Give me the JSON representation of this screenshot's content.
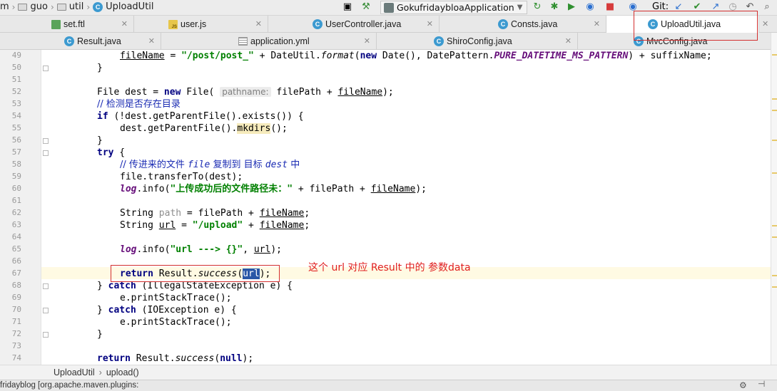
{
  "navbar": {
    "crumbs": [
      "m",
      "guo",
      "util",
      "UploadUtil"
    ],
    "run_config": "GokufridaybloaApplication",
    "git_label": "Git:"
  },
  "tabs_row1": [
    {
      "label": "set.ftl",
      "icon": "ftl-file-icon"
    },
    {
      "label": "user.js",
      "icon": "js-file-icon"
    },
    {
      "label": "UserController.java",
      "icon": "class-icon"
    },
    {
      "label": "Consts.java",
      "icon": "class-icon"
    },
    {
      "label": "UploadUtil.java",
      "icon": "class-icon",
      "active": true
    }
  ],
  "tabs_row2": [
    {
      "label": "Result.java",
      "icon": "class-icon"
    },
    {
      "label": "application.yml",
      "icon": "yml-file-icon"
    },
    {
      "label": "ShiroConfig.java",
      "icon": "class-icon"
    },
    {
      "label": "MvcConfig.java",
      "icon": "class-icon"
    }
  ],
  "editor": {
    "line_numbers": [
      "49",
      "50",
      "51",
      "52",
      "53",
      "54",
      "55",
      "56",
      "57",
      "58",
      "59",
      "60",
      "61",
      "62",
      "63",
      "64",
      "65",
      "66",
      "67",
      "68",
      "69",
      "70",
      "71",
      "72",
      "73",
      "74"
    ],
    "code": {
      "l49_var": "fileName",
      "l49_str": "\"/post/post_\"",
      "l49_rest": " + DateUtil.",
      "l49_fmt": "format",
      "l49_new": "new",
      "l49_date": " Date(), DatePattern.",
      "l49_const": "PURE_DATETIME_MS_PATTERN",
      "l49_end": ") + suffixName;",
      "l52_a": "File dest = ",
      "l52_new": "new",
      "l52_b": " File(",
      "l52_hint": "pathname:",
      "l52_c": " filePath + ",
      "l52_d": "fileName",
      "l52_e": ");",
      "l53_comment": "// 检测是否存在目录",
      "l54_if": "if",
      "l54_rest": " (!dest.getParentFile().exists()) {",
      "l55_a": "dest.getParentFile().",
      "l55_warn": "mkdirs",
      "l55_b": "();",
      "l57_try": "try",
      "l58_c1": "// 传进来的文件 ",
      "l58_file": "file",
      "l58_c2": " 复制到 目标 ",
      "l58_dest": "dest",
      "l58_c3": " 中",
      "l59": "file.transferTo(dest);",
      "l60_log": "log",
      "l60_a": ".info(",
      "l60_str": "\"上传成功后的文件路径未：\"",
      "l60_b": " + filePath + ",
      "l60_fn": "fileName",
      "l60_c": ");",
      "l62_a": "String ",
      "l62_var": "path",
      "l62_b": " = filePath + ",
      "l62_fn": "fileName",
      "l62_c": ";",
      "l63_a": "String ",
      "l63_var": "url",
      "l63_b": " = ",
      "l63_str": "\"/upload\"",
      "l63_c": " + ",
      "l63_fn": "fileName",
      "l63_d": ";",
      "l65_log": "log",
      "l65_a": ".info(",
      "l65_str": "\"url ---> {}\"",
      "l65_b": ", ",
      "l65_url": "url",
      "l65_c": ");",
      "l67_ret": "return",
      "l67_a": " Result.",
      "l67_succ": "success",
      "l67_b": "(",
      "l67_url": "url",
      "l67_c": ");",
      "l68_a": "} ",
      "l68_catch": "catch",
      "l68_b": " (IllegalStateException e) {",
      "l69": "e.printStackTrace();",
      "l70_a": "} ",
      "l70_catch": "catch",
      "l70_b": " (IOException e) {",
      "l71": "e.printStackTrace();",
      "l74_ret": "return",
      "l74_a": " Result.",
      "l74_succ": "success",
      "l74_b": "(",
      "l74_null": "null",
      "l74_c": ");"
    },
    "annotation": "这个 url 对应 Result 中的 参数data"
  },
  "breadcrumb": {
    "class": "UploadUtil",
    "sep": "›",
    "method": "upload()"
  },
  "bottom_bar": {
    "text": "fridayblog [org.apache.maven.plugins:"
  }
}
